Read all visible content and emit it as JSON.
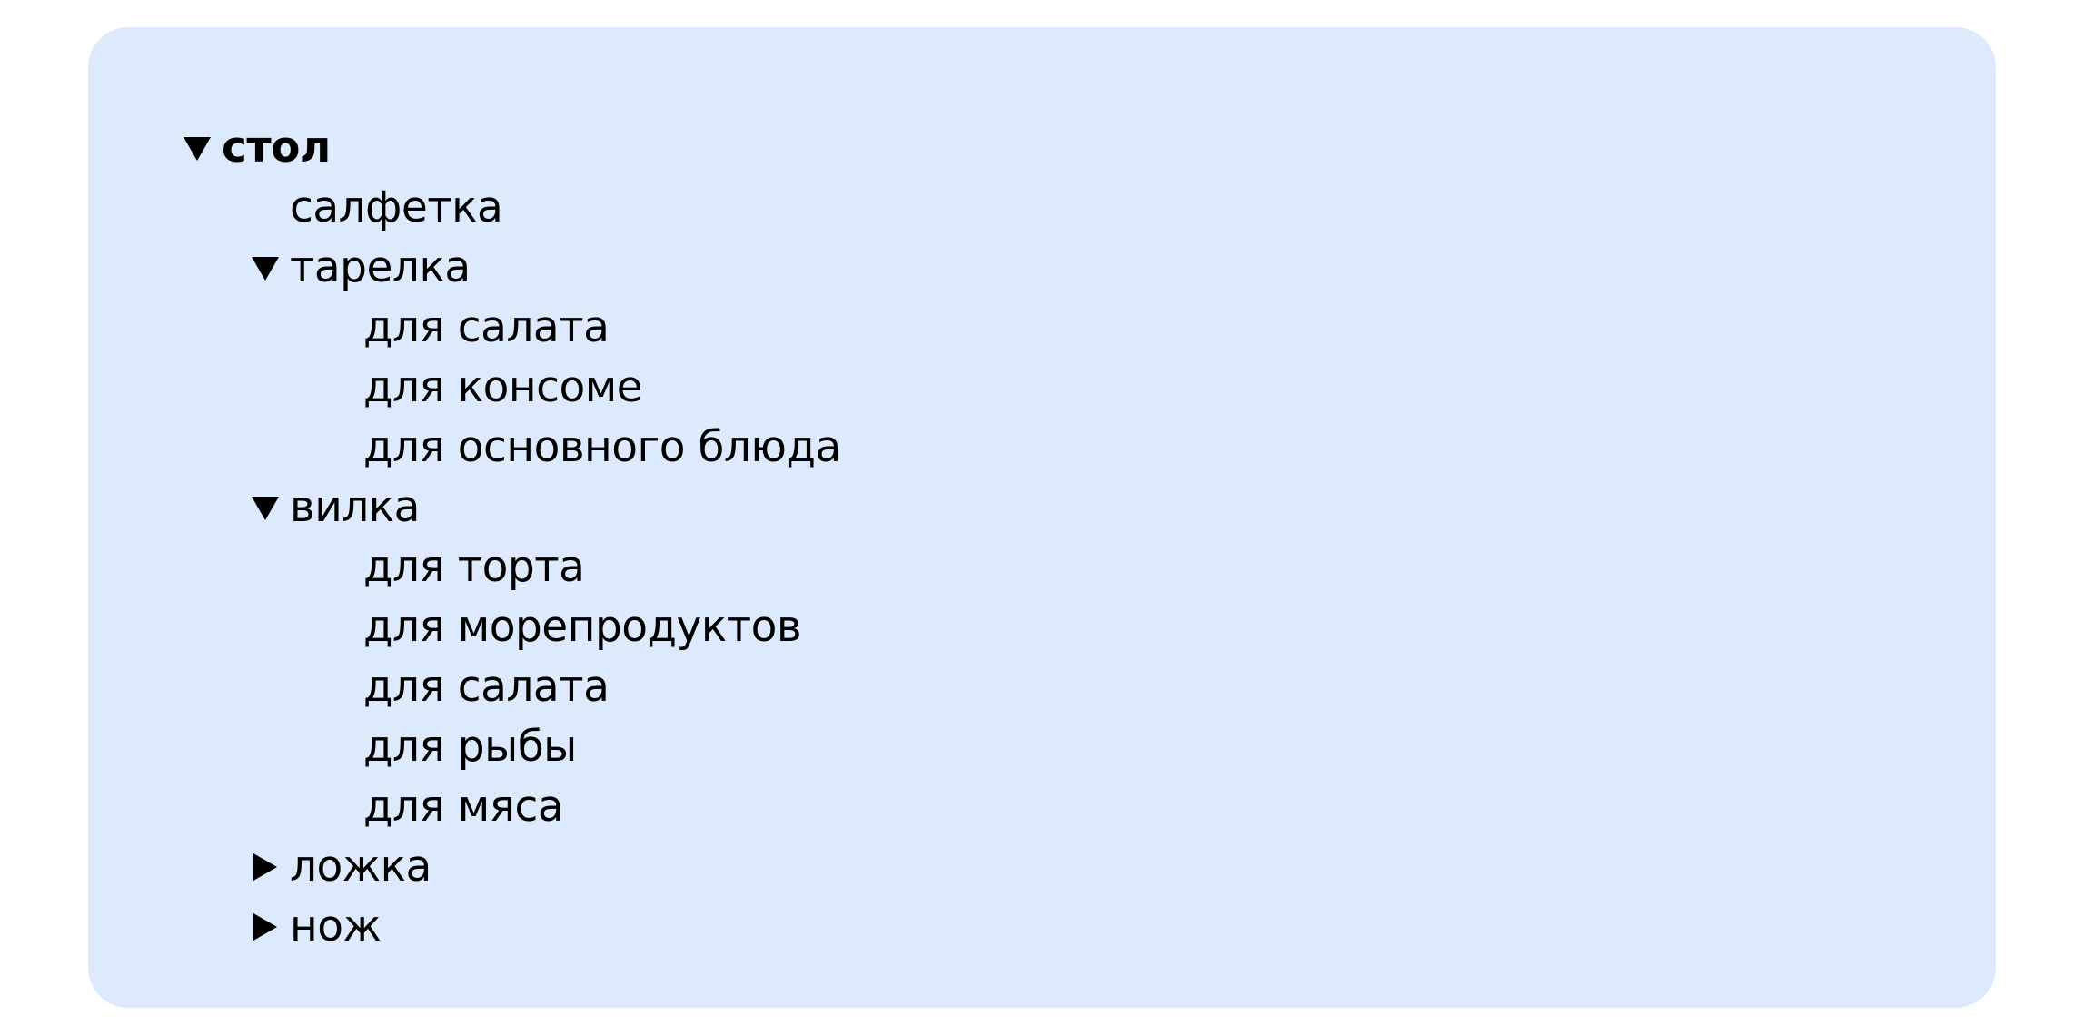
{
  "tree": {
    "root": {
      "label": "стол",
      "expanded": true
    },
    "napkin": {
      "label": "салфетка"
    },
    "plate": {
      "label": "тарелка",
      "expanded": true,
      "children": [
        "для салата",
        "для консоме",
        "для основного блюда"
      ]
    },
    "fork": {
      "label": "вилка",
      "expanded": true,
      "children": [
        "для торта",
        "для морепродуктов",
        "для салата",
        "для рыбы",
        "для мяса"
      ]
    },
    "spoon": {
      "label": "ложка",
      "expanded": false
    },
    "knife": {
      "label": "нож",
      "expanded": false
    }
  }
}
